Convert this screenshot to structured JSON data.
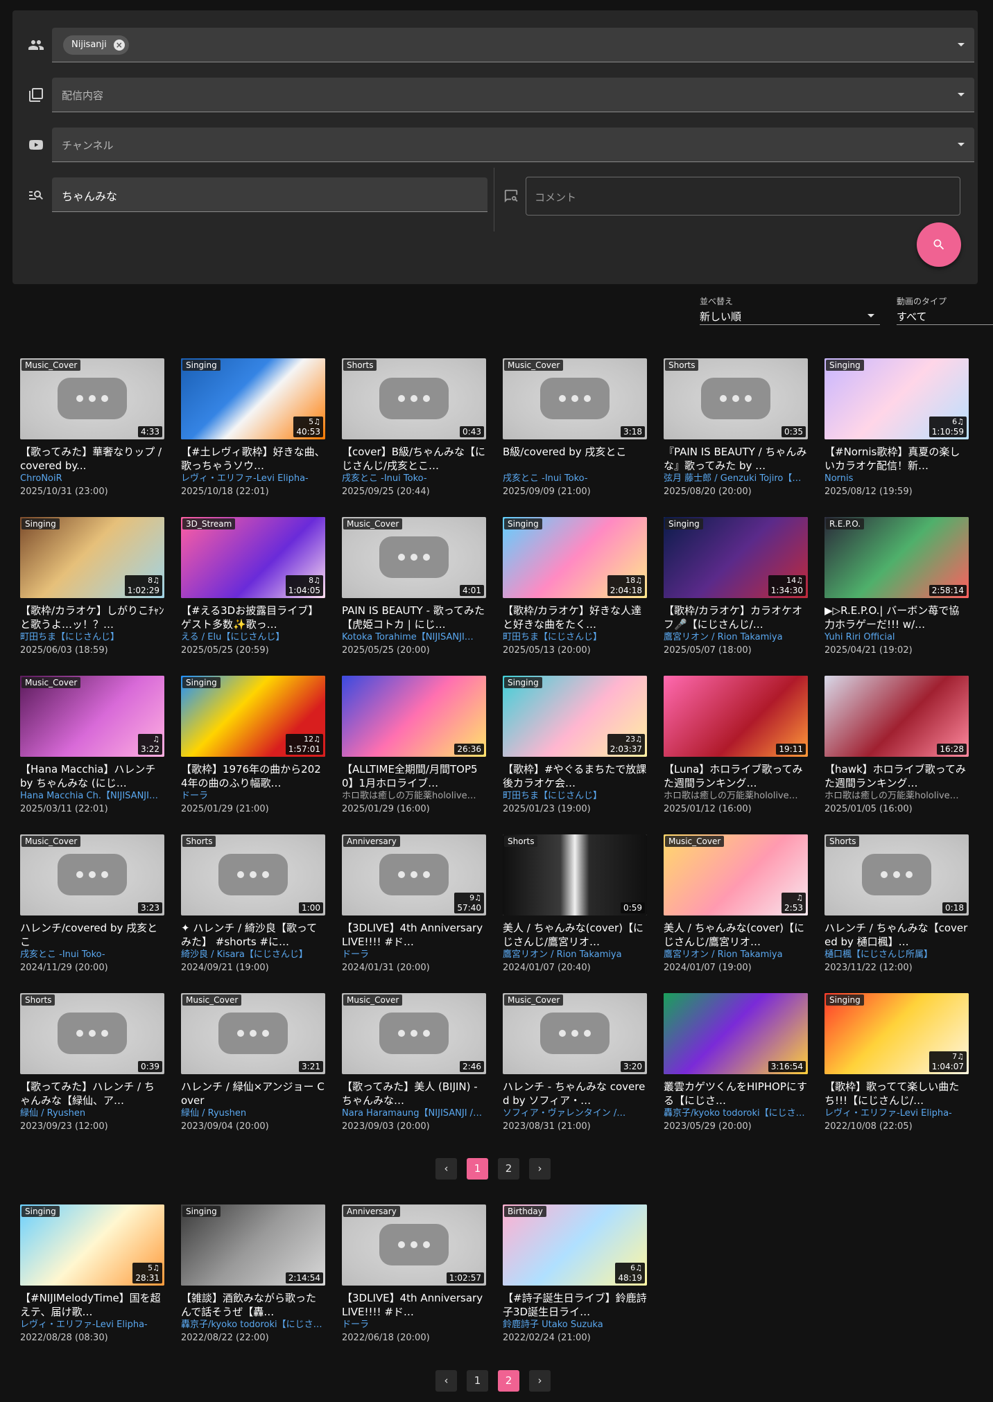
{
  "search": {
    "member_chip": "Nijisanji",
    "content_placeholder": "配信内容",
    "channel_placeholder": "チャンネル",
    "keyword_value": "ちゃんみな",
    "comment_placeholder": "コメント"
  },
  "sort": {
    "order_label": "並べ替え",
    "order_value": "新しい順",
    "type_label": "動画のタイプ",
    "type_value": "すべて"
  },
  "colors": {
    "accent": "#f06292",
    "channel_link": "#5aa8f0",
    "background": "#121212",
    "panel": "#272727"
  },
  "videos": [
    {
      "tag": "Music_Cover",
      "duration": "4:33",
      "title": "【歌ってみた】華奢なりップ / covered by...",
      "channel": "ChroNoiR",
      "date": "2025/10/31 (23:00)",
      "thumb": "placeholder"
    },
    {
      "tag": "Singing",
      "duration": "40:53",
      "songs": "5♫",
      "title": "【#土レヴィ歌枠】好きな曲、歌っちゃうソウ…",
      "channel": "レヴィ・エリファ-Levi Elipha-",
      "date": "2025/10/18 (22:01)",
      "thumb": "art-kanji"
    },
    {
      "tag": "Shorts",
      "duration": "0:43",
      "title": "【cover】B級/ちゃんみな【にじさんじ/戌亥とこ…",
      "channel": "戌亥とこ -Inui Toko-",
      "date": "2025/09/25 (20:44)",
      "thumb": "placeholder"
    },
    {
      "tag": "Music_Cover",
      "duration": "3:18",
      "title": "B級/covered by 戌亥とこ",
      "channel": "戌亥とこ -Inui Toko-",
      "date": "2025/09/09 (21:00)",
      "thumb": "placeholder"
    },
    {
      "tag": "Shorts",
      "duration": "0:35",
      "title": "『PAIN IS BEAUTY / ちゃんみな』歌ってみた by …",
      "channel": "弦月 藤士郎 / Genzuki Tojiro【…",
      "date": "2025/08/20 (20:00)",
      "thumb": "placeholder"
    },
    {
      "tag": "Singing",
      "duration": "1:10:59",
      "songs": "6♫",
      "title": "【#Nornis歌枠】真夏の楽しいカラオケ配信！新…",
      "channel": "Nornis",
      "date": "2025/08/12 (19:59)",
      "thumb": "art-pastel"
    },
    {
      "tag": "Singing",
      "duration": "1:02:29",
      "songs": "8♫",
      "title": "【歌枠/カラオケ】しがりこﾁｬﾝと歌うよ…ッ！？…",
      "channel": "町田ちま【にじさんじ】",
      "date": "2025/06/03 (18:59)",
      "thumb": "art-warm"
    },
    {
      "tag": "3D_Stream",
      "duration": "1:04:05",
      "songs": "8♫",
      "title": "【#える3Dお披露目ライブ】ゲスト多数✨歌っ…",
      "channel": "える / Elu【にじさんじ】",
      "date": "2025/05/25 (20:59)",
      "thumb": "art-pink"
    },
    {
      "tag": "Music_Cover",
      "duration": "4:01",
      "title": "PAIN IS BEAUTY - 歌ってみた【虎姫コトカ | にじ…",
      "channel": "Kotoka Torahime【NIJISANJI…",
      "date": "2025/05/25 (20:00)",
      "thumb": "placeholder"
    },
    {
      "tag": "Singing",
      "duration": "2:04:18",
      "songs": "18♫",
      "title": "【歌枠/カラオケ】好きな人達と好きな曲をたく…",
      "channel": "町田ちま【にじさんじ】",
      "date": "2025/05/13 (20:00)",
      "thumb": "art-karaoke"
    },
    {
      "tag": "Singing",
      "duration": "1:34:30",
      "songs": "14♫",
      "title": "【歌枠/カラオケ】カラオケオフ🎤【にじさんじ/…",
      "channel": "鷹宮リオン / Rion Takamiya",
      "date": "2025/05/07 (18:00)",
      "thumb": "art-dark"
    },
    {
      "tag": "R.E.P.O.",
      "duration": "2:58:14",
      "title": "▶▷R.E.P.O.| バーボン苺で協力ホラゲーだ!!! w/…",
      "channel": "Yuhi Riri Official",
      "date": "2025/04/21 (19:02)",
      "thumb": "art-repo"
    },
    {
      "tag": "Music_Cover",
      "duration": "3:22",
      "songs": "♫",
      "title": "【Hana Macchia】ハレンチ by ちゃんみな (にじ…",
      "channel": "Hana Macchia Ch.【NIJISANJI…",
      "date": "2025/03/11 (22:01)",
      "thumb": "art-purple"
    },
    {
      "tag": "Singing",
      "duration": "1:57:01",
      "songs": "12♫",
      "title": "【歌枠】1976年の曲から2024年の曲のふり幅歌…",
      "channel": "ドーラ",
      "date": "2025/01/29 (21:00)",
      "thumb": "art-red"
    },
    {
      "tag": "",
      "duration": "26:36",
      "title": "【ALLTIME全期間/月間TOP50】1月ホロライブ…",
      "channel": "ホロ歌は癒しの万能薬hololive…",
      "channel_gray": true,
      "date": "2025/01/29 (16:00)",
      "thumb": "art-top50"
    },
    {
      "tag": "Singing",
      "duration": "2:03:37",
      "songs": "23♫",
      "title": "【歌枠】#やぐるまちたで放課後カラオケ会…",
      "channel": "町田ちま【にじさんじ】",
      "date": "2025/01/23 (19:00)",
      "thumb": "art-karaoke2"
    },
    {
      "tag": "",
      "duration": "19:11",
      "title": "【Luna】ホロライブ歌ってみた週間ランキング…",
      "channel": "ホロ歌は癒しの万能薬hololive…",
      "channel_gray": true,
      "date": "2025/01/12 (16:00)",
      "thumb": "art-rank1"
    },
    {
      "tag": "",
      "duration": "16:28",
      "title": "【hawk】ホロライブ歌ってみた週間ランキング…",
      "channel": "ホロ歌は癒しの万能薬hololive…",
      "channel_gray": true,
      "date": "2025/01/05 (16:00)",
      "thumb": "art-rank2"
    },
    {
      "tag": "Music_Cover",
      "duration": "3:23",
      "title": "ハレンチ/covered by 戌亥とこ",
      "channel": "戌亥とこ -Inui Toko-",
      "date": "2024/11/29 (20:00)",
      "thumb": "placeholder"
    },
    {
      "tag": "Shorts",
      "duration": "1:00",
      "title": "✦ ハレンチ / 綺沙良【歌ってみた】 #shorts #に…",
      "channel": "綺沙良 / Kisara【にじさんじ】",
      "date": "2024/09/21 (19:00)",
      "thumb": "placeholder"
    },
    {
      "tag": "Anniversary",
      "duration": "57:40",
      "songs": "9♫",
      "title": "【3DLIVE】4th Anniversary LIVE!!!! #ド…",
      "channel": "ドーラ",
      "date": "2024/01/31 (20:00)",
      "thumb": "placeholder"
    },
    {
      "tag": "Shorts",
      "duration": "0:59",
      "title": "美人 / ちゃんみな(cover)【にじさんじ/鷹宮リオ…",
      "channel": "鷹宮リオン / Rion Takamiya",
      "date": "2024/01/07 (20:40)",
      "thumb": "art-stage"
    },
    {
      "tag": "Music_Cover",
      "duration": "2:53",
      "songs": "♫",
      "title": "美人 / ちゃんみな(cover)【にじさんじ/鷹宮リオ…",
      "channel": "鷹宮リオン / Rion Takamiya",
      "date": "2024/01/07 (19:00)",
      "thumb": "art-bijin"
    },
    {
      "tag": "Shorts",
      "duration": "0:18",
      "title": "ハレンチ / ちゃんみな【covered by 樋口楓】…",
      "channel": "樋口楓【にじさんじ所属】",
      "date": "2023/11/22 (12:00)",
      "thumb": "placeholder"
    },
    {
      "tag": "Shorts",
      "duration": "0:39",
      "title": "【歌ってみた】ハレンチ / ちゃんみな【緑仙、ア…",
      "channel": "緑仙 / Ryushen",
      "date": "2023/09/23 (12:00)",
      "thumb": "placeholder"
    },
    {
      "tag": "Music_Cover",
      "duration": "3:21",
      "title": "ハレンチ / 緑仙×アンジョー Cover",
      "channel": "緑仙 / Ryushen",
      "date": "2023/09/04 (20:00)",
      "thumb": "placeholder"
    },
    {
      "tag": "Music_Cover",
      "duration": "2:46",
      "title": "【歌ってみた】美人 (BIJIN) - ちゃんみな…",
      "channel": "Nara Haramaung【NIJISANJI /…",
      "date": "2023/09/03 (20:00)",
      "thumb": "placeholder"
    },
    {
      "tag": "Music_Cover",
      "duration": "3:20",
      "title": "ハレンチ - ちゃんみな covered by ソフィア・…",
      "channel": "ソフィア・ヴァレンタイン /…",
      "date": "2023/08/31 (21:00)",
      "thumb": "placeholder"
    },
    {
      "tag": "",
      "duration": "3:16:54",
      "title": "叢雲カゲツくんをHIPHOPにする【にじさ…",
      "channel": "轟京子/kyoko todoroki【にじさ…",
      "date": "2023/05/29 (20:00)",
      "thumb": "art-hiphop"
    },
    {
      "tag": "Singing",
      "duration": "1:04:07",
      "songs": "7♫",
      "title": "【歌枠】歌ってて楽しい曲たち!!!【にじさんじ/…",
      "channel": "レヴィ・エリファ-Levi Elipha-",
      "date": "2022/10/08 (22:05)",
      "thumb": "art-utawaku"
    }
  ],
  "pager_top": {
    "prev": "‹",
    "pages": [
      "1",
      "2"
    ],
    "active": "1",
    "next": "›"
  },
  "videos_page2": [
    {
      "tag": "Singing",
      "duration": "28:31",
      "songs": "5♫",
      "title": "【#NIJIMelodyTime】国を超えテ、届け歌…",
      "channel": "レヴィ・エリファ-Levi Elipha-",
      "date": "2022/08/28 (08:30)",
      "thumb": "art-melody"
    },
    {
      "tag": "Singing",
      "duration": "2:14:54",
      "title": "【雑談】酒飲みながら歌ったんで話そうぜ【轟…",
      "channel": "轟京子/kyoko todoroki【にじさ…",
      "date": "2022/08/22 (22:00)",
      "thumb": "art-karaoke3"
    },
    {
      "tag": "Anniversary",
      "duration": "1:02:57",
      "title": "【3DLIVE】4th Anniversary LIVE!!!! #ド…",
      "channel": "ドーラ",
      "date": "2022/06/18 (20:00)",
      "thumb": "placeholder"
    },
    {
      "tag": "Birthday",
      "duration": "48:19",
      "songs": "6♫",
      "title": "【#詩子誕生日ライブ】鈴鹿詩子3D誕生日ライ…",
      "channel": "鈴鹿詩子 Utako Suzuka",
      "date": "2022/02/24 (21:00)",
      "thumb": "art-birthday"
    }
  ],
  "pager_bottom": {
    "prev": "‹",
    "pages": [
      "1",
      "2"
    ],
    "active": "2",
    "next": "›"
  }
}
